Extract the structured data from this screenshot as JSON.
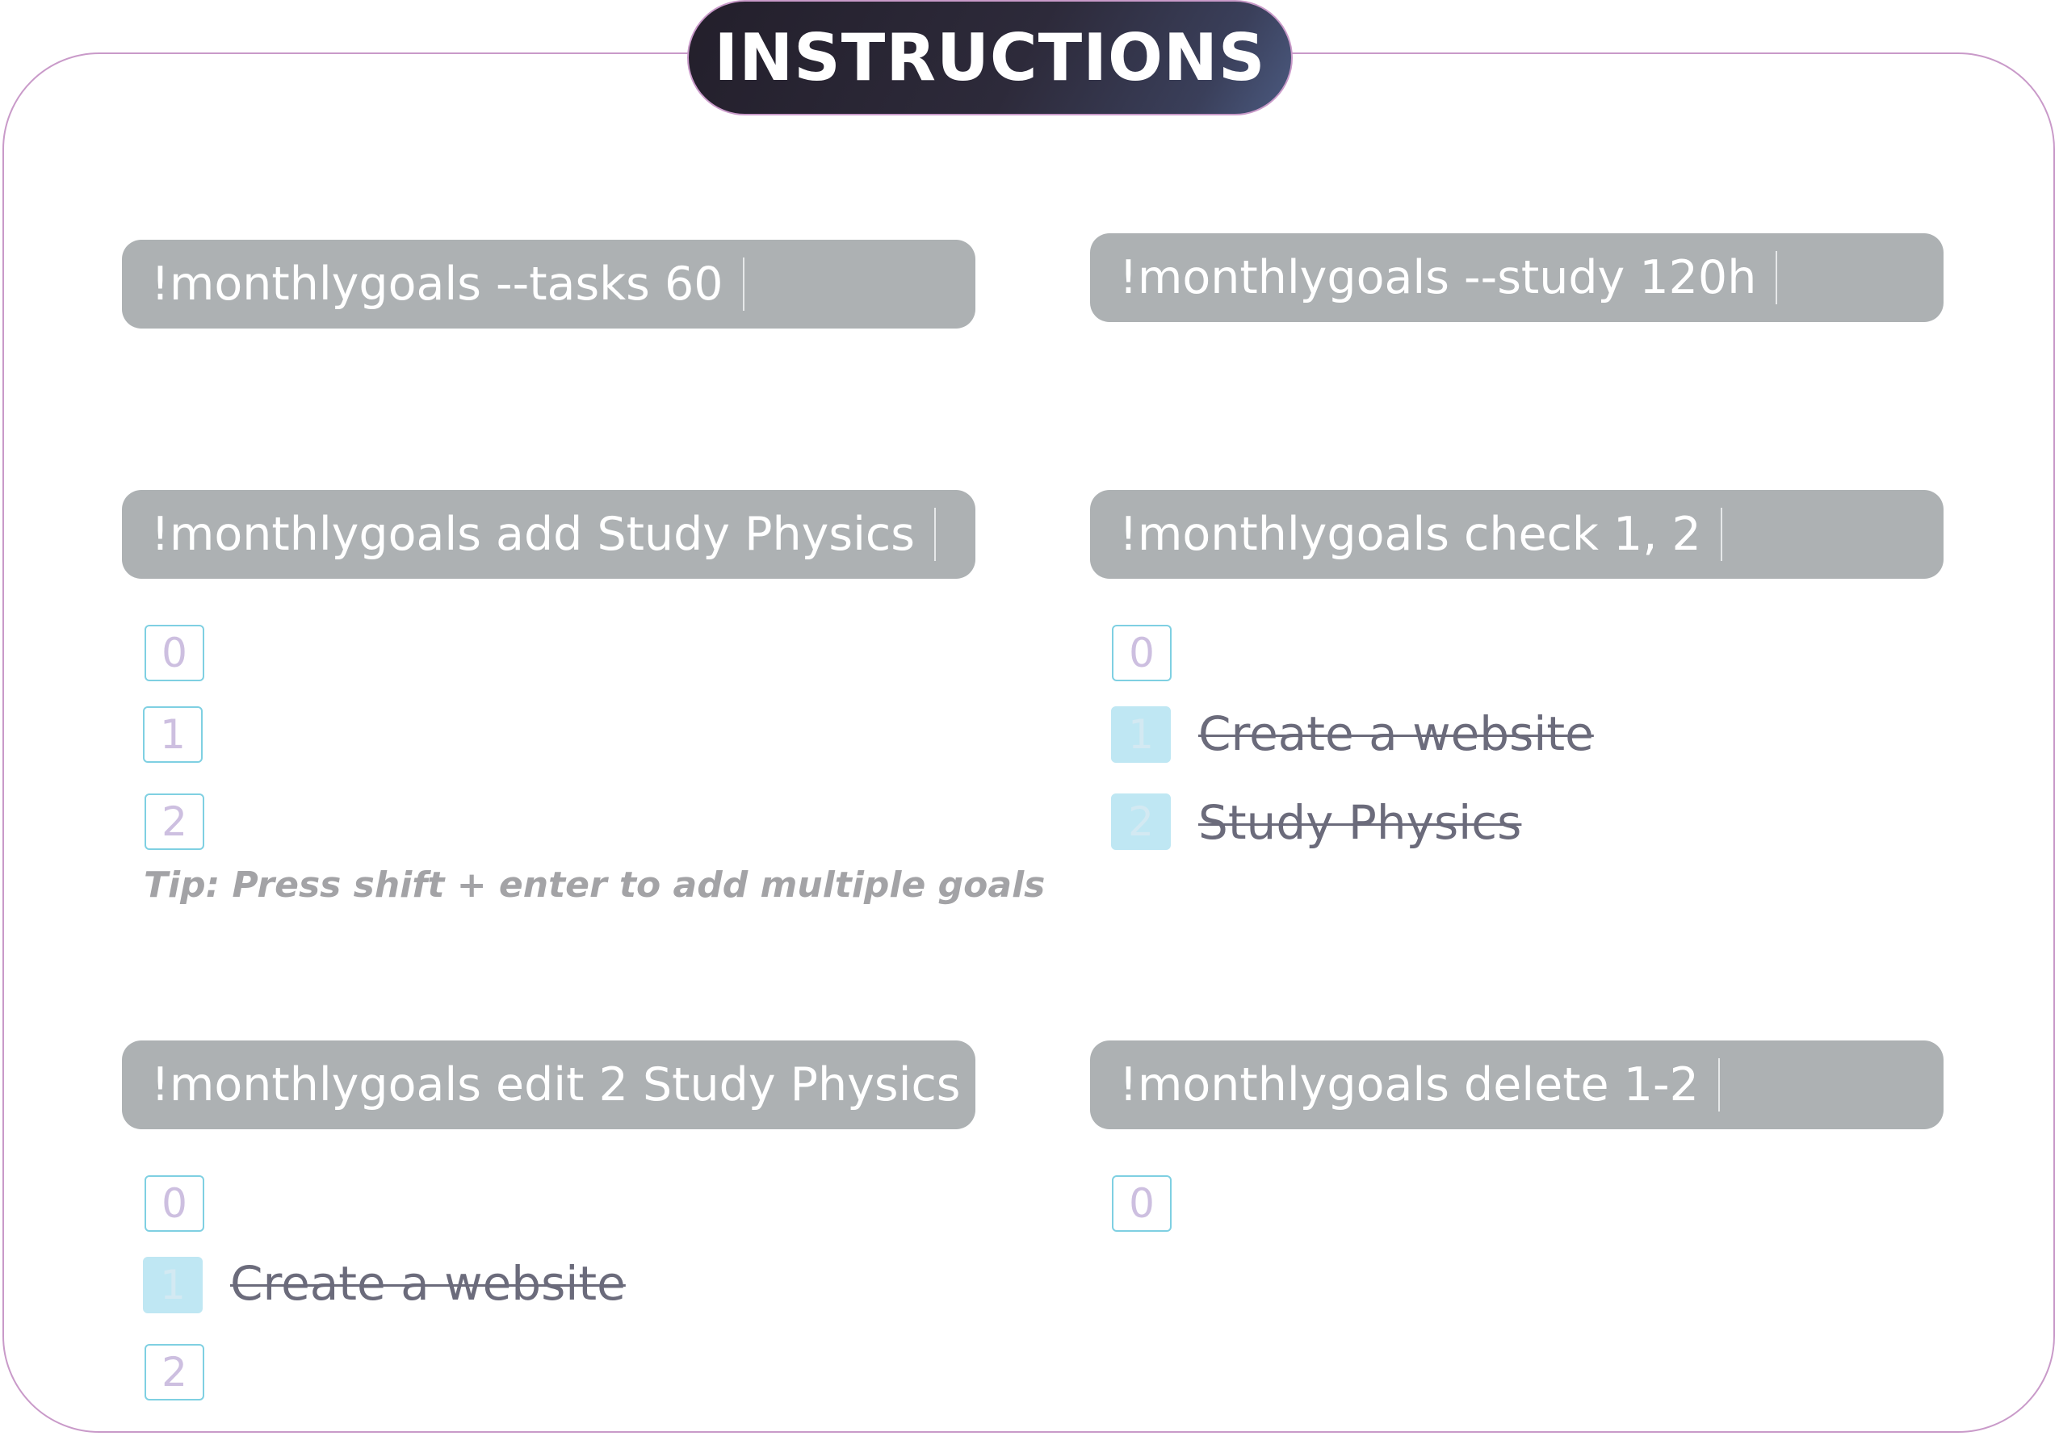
{
  "title": "INSTRUCTIONS",
  "colors": {
    "frame_border": "#c99ac9",
    "command_bar": "#adb1b3",
    "box_border": "#7fd0e2",
    "checked_fill": "#bfe7f3",
    "title_bg": "#2d2a3a"
  },
  "panels": {
    "tasks": {
      "command": "!monthlygoals --tasks 60"
    },
    "study": {
      "command": "!monthlygoals --study 120h"
    },
    "add": {
      "command": "!monthlygoals add Study Physics",
      "items": [
        {
          "number": "0",
          "text": "",
          "checked": false
        },
        {
          "number": "1",
          "text": "",
          "checked": false
        },
        {
          "number": "2",
          "text": "",
          "checked": false
        }
      ],
      "tip": "Tip: Press shift + enter to add multiple goals"
    },
    "check": {
      "command": "!monthlygoals check 1, 2",
      "items": [
        {
          "number": "0",
          "text": "",
          "checked": false
        },
        {
          "number": "1",
          "text": "Create a website",
          "checked": true
        },
        {
          "number": "2",
          "text": "Study Physics",
          "checked": true
        }
      ]
    },
    "edit": {
      "command": "!monthlygoals edit 2 Study Physics",
      "items": [
        {
          "number": "0",
          "text": "",
          "checked": false
        },
        {
          "number": "1",
          "text": "Create a website",
          "checked": true
        },
        {
          "number": "2",
          "text": "",
          "checked": false
        }
      ]
    },
    "delete": {
      "command": "!monthlygoals delete 1-2",
      "items": [
        {
          "number": "0",
          "text": "",
          "checked": false
        }
      ]
    }
  }
}
